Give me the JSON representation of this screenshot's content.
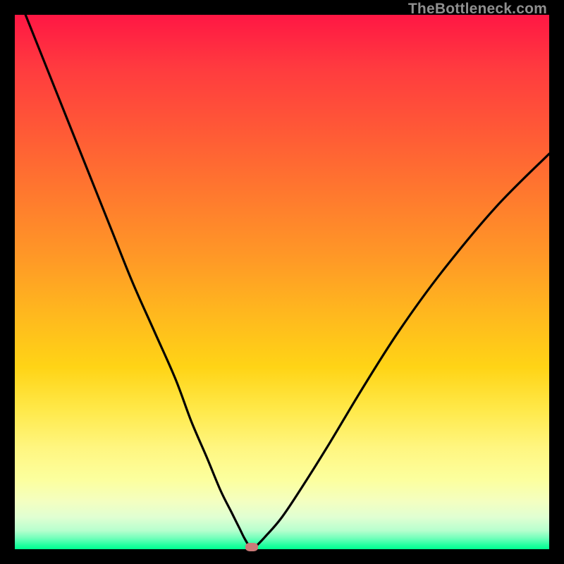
{
  "watermark": "TheBottleneck.com",
  "colors": {
    "frame": "#000000",
    "curve": "#000000",
    "marker": "#cb7a78",
    "gradient_stops": [
      "#ff1744",
      "#ff3b3f",
      "#ff5a36",
      "#ff7a2e",
      "#ff9a26",
      "#ffb81e",
      "#ffd416",
      "#ffe94a",
      "#fff680",
      "#fcff9e",
      "#f4ffc0",
      "#e0ffd2",
      "#b7ffce",
      "#6effba",
      "#1eff9e",
      "#00ff90"
    ]
  },
  "chart_data": {
    "type": "line",
    "title": "",
    "xlabel": "",
    "ylabel": "",
    "xlim": [
      0,
      100
    ],
    "ylim": [
      0,
      100
    ],
    "grid": false,
    "series": [
      {
        "name": "bottleneck-curve",
        "x": [
          2,
          6,
          10,
          14,
          18,
          22,
          26,
          30,
          33,
          36,
          38.5,
          40.5,
          42,
          43,
          44,
          45,
          47,
          50,
          54,
          59,
          65,
          72,
          80,
          90,
          100
        ],
        "y": [
          100,
          90,
          80,
          70,
          60,
          50,
          41,
          32,
          24,
          17,
          11,
          7,
          4,
          2,
          0.5,
          0.5,
          2.5,
          6,
          12,
          20,
          30,
          41,
          52,
          64,
          74
        ]
      }
    ],
    "annotations": [
      {
        "name": "optimal-point",
        "x": 44.3,
        "y": 0.4
      }
    ]
  }
}
